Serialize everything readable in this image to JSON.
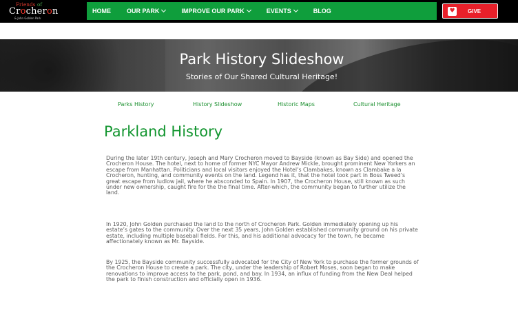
{
  "logo": {
    "line1_prefix": "Friends",
    "line1_of": " of",
    "line2_a": "Cr",
    "line2_accent": "o",
    "line2_b": "cher",
    "line2_accent2": "o",
    "line2_c": "n",
    "line3": "& John Golden Park"
  },
  "nav": {
    "items": [
      {
        "label": "HOME"
      },
      {
        "label": "OUR PARK"
      },
      {
        "label": "IMPROVE OUR PARK"
      },
      {
        "label": "EVENTS"
      },
      {
        "label": "BLOG"
      }
    ]
  },
  "give": {
    "label": "GIVE"
  },
  "hero": {
    "title": "Park History Slideshow",
    "subtitle": "Stories of Our Shared Cultural Heritage!"
  },
  "subnav": {
    "items": [
      {
        "label": "Parks History"
      },
      {
        "label": "History Slideshow"
      },
      {
        "label": "Historic Maps"
      },
      {
        "label": "Cultural Heritage"
      }
    ]
  },
  "content": {
    "title": "Parkland History",
    "paragraphs": [
      "During the later 19th century, Joseph and Mary Crocheron moved to Bayside (known as Bay Side) and opened the Crocheron House.  The hotel, next to home of former NYC Mayor Andrew Mickle,  brought prominent New Yorkers an escape from Manhattan.  Politicians and local visitors enjoyed the Hotel’s Clambakes, known as Clambake a la Crocheron, hunting, and community events on the land.  Legend has it,  that the hotel took part in Boss Tweed’s great escape from ludlow jail, where he absconded to Spain.  In 1907, the Crocheron House, still known as such under new ownership,  caught fire for the the final time.  After-which, the community began to further utilize the land.",
      "In 1920, John Golden purchased the land to the north of Crocheron Park.  Golden immediately opening up his estate’s gates to the community.  Over the next 35 years, John Golden established community ground on his private estate, including multiple baseball fields.  For this, and his additional advocacy for the town, he became affectionately known as Mr. Bayside.",
      "By 1925, the Bayside community successfully advocated for the City of New York to purchase the former grounds of the Crocheron House to create a park.  The city, under the leadership of Robert Moses, soon began to make  renovations to improve access to the park, pond, and bay.  In 1934, an influx of funding from the New Deal helped the park to finish construction and officially open in 1936."
    ]
  },
  "colors": {
    "nav_green": "#0f9e3c",
    "give_red": "#e8202a",
    "title_green": "#12952f"
  }
}
